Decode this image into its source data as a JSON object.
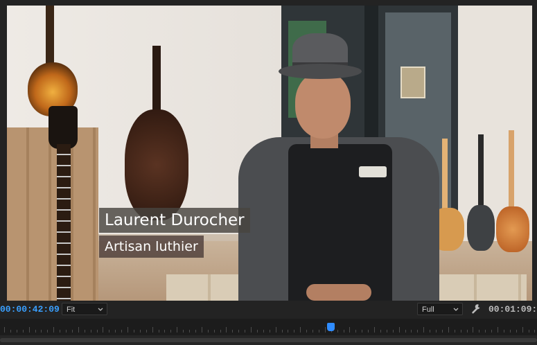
{
  "viewer": {
    "lower_third": {
      "name": "Laurent Durocher",
      "title": "Artisan luthier"
    }
  },
  "controls": {
    "current_timecode": "00:00:42:09",
    "zoom_value": "Fit",
    "resolution_value": "Full",
    "duration_timecode": "00:01:09:0"
  },
  "icons": {
    "wrench": "wrench-icon",
    "dropdown": "chevron-down-icon"
  },
  "colors": {
    "timecode_accent": "#3aa0ff",
    "playhead": "#2f8cff",
    "panel_bg": "#232323"
  },
  "timeline": {
    "playhead_fraction": 0.615
  }
}
